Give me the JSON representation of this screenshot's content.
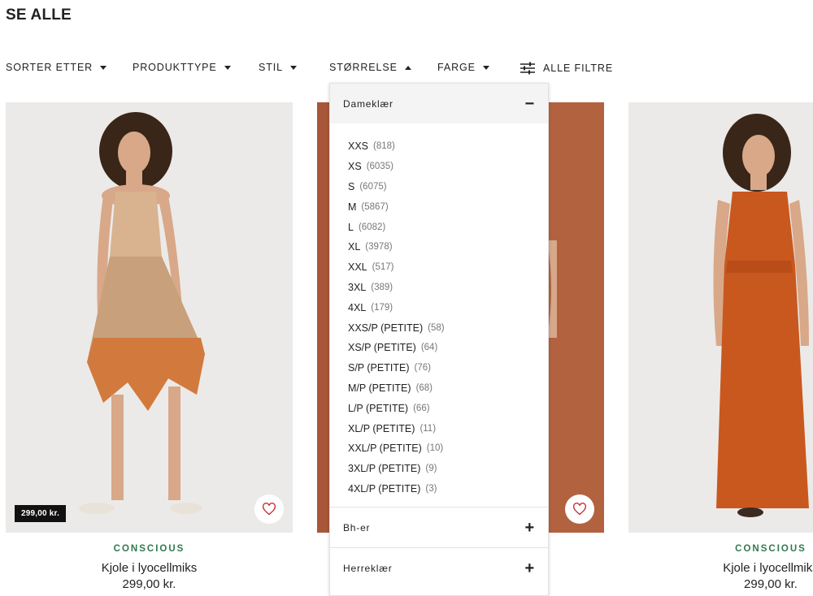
{
  "page": {
    "title": "SE ALLE"
  },
  "filters": {
    "sort": "SORTER ETTER",
    "product_type": "PRODUKTTYPE",
    "style": "STIL",
    "size": "STØRRELSE",
    "color": "FARGE",
    "all_filters": "ALLE FILTRE"
  },
  "size_dropdown": {
    "sections": [
      {
        "label": "Dameklær",
        "expanded": true,
        "toggle": "−"
      },
      {
        "label": "Bh-er",
        "expanded": false,
        "toggle": "+"
      },
      {
        "label": "Herreklær",
        "expanded": false,
        "toggle": "+"
      }
    ],
    "sizes": [
      {
        "label": "XXS",
        "count": "(818)"
      },
      {
        "label": "XS",
        "count": "(6035)"
      },
      {
        "label": "S",
        "count": "(6075)"
      },
      {
        "label": "M",
        "count": "(5867)"
      },
      {
        "label": "L",
        "count": "(6082)"
      },
      {
        "label": "XL",
        "count": "(3978)"
      },
      {
        "label": "XXL",
        "count": "(517)"
      },
      {
        "label": "3XL",
        "count": "(389)"
      },
      {
        "label": "4XL",
        "count": "(179)"
      },
      {
        "label": "XXS/P (PETITE)",
        "count": "(58)"
      },
      {
        "label": "XS/P (PETITE)",
        "count": "(64)"
      },
      {
        "label": "S/P (PETITE)",
        "count": "(76)"
      },
      {
        "label": "M/P (PETITE)",
        "count": "(68)"
      },
      {
        "label": "L/P (PETITE)",
        "count": "(66)"
      },
      {
        "label": "XL/P (PETITE)",
        "count": "(11)"
      },
      {
        "label": "XXL/P (PETITE)",
        "count": "(10)"
      },
      {
        "label": "3XL/P (PETITE)",
        "count": "(9)"
      },
      {
        "label": "4XL/P (PETITE)",
        "count": "(3)"
      }
    ]
  },
  "products": [
    {
      "badge_price": "299,00 kr.",
      "tag": "CONSCIOUS",
      "name": "Kjole i lyocellmiks",
      "price": "299,00 kr."
    },
    {
      "badge_price": "",
      "tag": "",
      "name": "",
      "price": ""
    },
    {
      "badge_price": "",
      "tag": "CONSCIOUS",
      "name": "Kjole i lyocellmiks",
      "price": "299,00 kr."
    }
  ],
  "colors": {
    "accent_green": "#2f7a4d",
    "heart_red": "#c8202f",
    "badge_bg": "#111111"
  },
  "icons": {
    "heart": "heart-icon",
    "sliders": "sliders-icon"
  }
}
